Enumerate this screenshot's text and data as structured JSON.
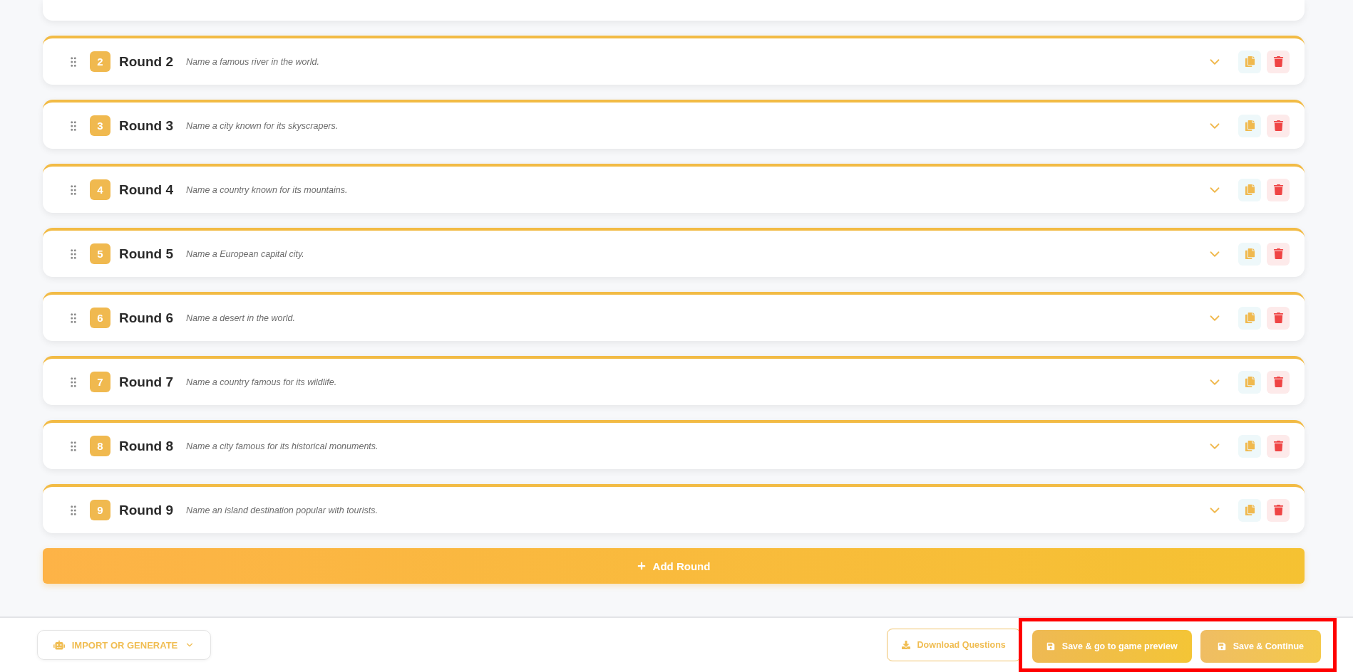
{
  "rounds": [
    {
      "number": "2",
      "title": "Round 2",
      "prompt": "Name a famous river in the world."
    },
    {
      "number": "3",
      "title": "Round 3",
      "prompt": "Name a city known for its skyscrapers."
    },
    {
      "number": "4",
      "title": "Round 4",
      "prompt": "Name a country known for its mountains."
    },
    {
      "number": "5",
      "title": "Round 5",
      "prompt": "Name a European capital city."
    },
    {
      "number": "6",
      "title": "Round 6",
      "prompt": "Name a desert in the world."
    },
    {
      "number": "7",
      "title": "Round 7",
      "prompt": "Name a country famous for its wildlife."
    },
    {
      "number": "8",
      "title": "Round 8",
      "prompt": "Name a city famous for its historical monuments."
    },
    {
      "number": "9",
      "title": "Round 9",
      "prompt": "Name an island destination popular with tourists."
    }
  ],
  "add_round_button": "Add Round",
  "footer": {
    "import_button": "IMPORT OR GENERATE",
    "download_button": "Download Questions",
    "save_preview_button": "Save & go to game preview",
    "save_continue_button": "Save & Continue",
    "highlighted": true
  }
}
